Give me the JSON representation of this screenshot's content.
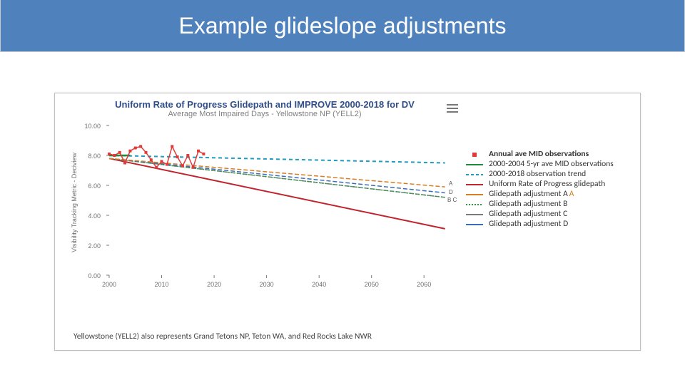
{
  "title": "Example glideslope adjustments",
  "chart_title": "Uniform Rate of Progress Glidepath and IMPROVE 2000-2018 for DV",
  "chart_subtitle": "Average Most Impaired Days - Yellowstone NP (YELL2)",
  "footnote": "Yellowstone (YELL2) also represents Grand Tetons NP, Teton WA, and Red Rocks Lake NWR",
  "y_axis_label": "Visibility Tracking Metric - Deciview",
  "menu_icon_title": "chart-menu",
  "repeated_label_A": "A",
  "legend": {
    "items": [
      {
        "label": "Annual ave MID observations",
        "swatch": "square-red",
        "bold": true
      },
      {
        "label": "2000-2004 5-yr ave MID observations",
        "swatch": "line-green"
      },
      {
        "label": "2000-2018 observation trend",
        "swatch": "line-teal-dash"
      },
      {
        "label": "Uniform Rate of Progress glidepath",
        "swatch": "line-red-solid"
      },
      {
        "label": "Glidepath adjustment A",
        "swatch": "line-orange",
        "suffix_repeated_A": true
      },
      {
        "label": "Glidepath adjustment B",
        "swatch": "line-green-dash"
      },
      {
        "label": "Glidepath adjustment C",
        "swatch": "line-grey"
      },
      {
        "label": "Glidepath adjustment D",
        "swatch": "line-blue"
      }
    ]
  },
  "annotations": {
    "A": "A",
    "D": "D",
    "B_C": "B C"
  },
  "chart_data": {
    "type": "line",
    "title": "Uniform Rate of Progress Glidepath and IMPROVE 2000-2018 for DV",
    "subtitle": "Average Most Impaired Days - Yellowstone NP (YELL2)",
    "xlabel": "",
    "ylabel": "Visibility Tracking Metric - Deciview",
    "xlim": [
      2000,
      2065
    ],
    "ylim": [
      0,
      10
    ],
    "x_ticks": [
      2000,
      2010,
      2020,
      2030,
      2040,
      2050,
      2060
    ],
    "y_ticks": [
      0,
      2,
      4,
      6,
      8,
      10
    ],
    "series": [
      {
        "name": "Annual ave MID observations",
        "type": "line-markers",
        "color": "#e03a3a",
        "x": [
          2000,
          2001,
          2002,
          2003,
          2004,
          2005,
          2006,
          2007,
          2008,
          2009,
          2010,
          2011,
          2012,
          2013,
          2014,
          2015,
          2016,
          2017,
          2018
        ],
        "y": [
          8.1,
          8.0,
          8.2,
          7.5,
          8.3,
          8.5,
          8.6,
          8.2,
          7.7,
          7.2,
          7.6,
          7.4,
          8.6,
          7.9,
          7.3,
          8.0,
          7.2,
          8.3,
          8.1
        ]
      },
      {
        "name": "2000-2004 5-yr ave MID observations",
        "type": "line",
        "color": "#1f8a37",
        "x": [
          2000,
          2004
        ],
        "y": [
          8.0,
          8.0
        ]
      },
      {
        "name": "2000-2018 observation trend",
        "type": "line",
        "dash": "dash",
        "color": "#1f9bbf",
        "x": [
          2000,
          2064
        ],
        "y": [
          8.0,
          7.5
        ]
      },
      {
        "name": "Uniform Rate of Progress glidepath",
        "type": "line",
        "color": "#c0252e",
        "x": [
          2000,
          2064
        ],
        "y": [
          7.8,
          3.1
        ]
      },
      {
        "name": "Glidepath adjustment A",
        "type": "line",
        "color": "#d87d20",
        "dash": "dash",
        "x": [
          2000,
          2064
        ],
        "y": [
          7.8,
          5.9
        ]
      },
      {
        "name": "Glidepath adjustment D",
        "type": "line",
        "color": "#3c6db8",
        "dash": "dash",
        "x": [
          2000,
          2064
        ],
        "y": [
          7.8,
          5.5
        ]
      },
      {
        "name": "Glidepath adjustment B",
        "type": "line",
        "color": "#2f9a46",
        "dash": "dot",
        "x": [
          2000,
          2064
        ],
        "y": [
          7.8,
          5.2
        ]
      },
      {
        "name": "Glidepath adjustment C",
        "type": "line",
        "color": "#7a7a7a",
        "x": [
          2000,
          2064
        ],
        "y": [
          7.8,
          5.2
        ]
      }
    ]
  }
}
